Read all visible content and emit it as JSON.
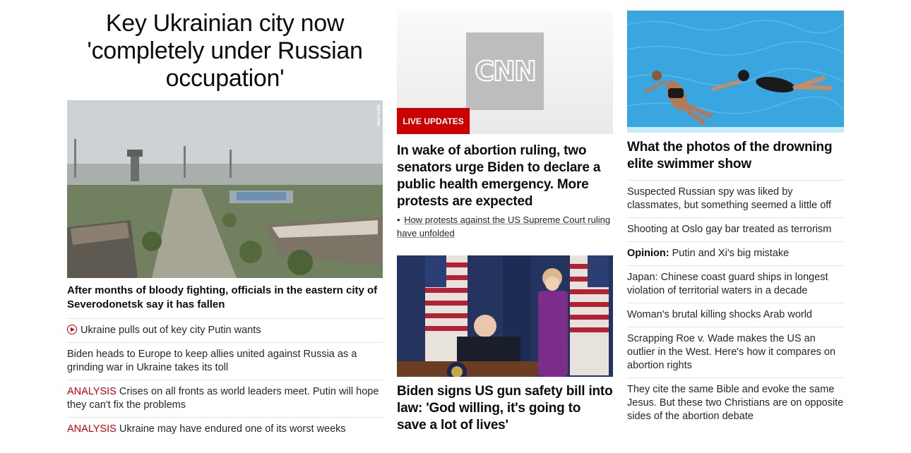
{
  "left": {
    "headline": "Key Ukrainian city now 'completely under Russian occupation'",
    "photo_credit": "REUTERS",
    "caption": "After months of bloody fighting, officials in the eastern city of Severodonetsk say it has fallen",
    "items": [
      {
        "tag": "",
        "text": "Ukraine pulls out of key city Putin wants",
        "video": true
      },
      {
        "tag": "",
        "text": "Biden heads to Europe to keep allies united against Russia as a grinding war in Ukraine takes its toll",
        "video": false
      },
      {
        "tag": "ANALYSIS",
        "text": " Crises on all fronts as world leaders meet. Putin will hope they can't fix the problems",
        "video": false
      },
      {
        "tag": "ANALYSIS",
        "text": " Ukraine may have endured one of its worst weeks",
        "video": false
      }
    ]
  },
  "middle": {
    "logo_text": "CNN",
    "badge": "LIVE UPDATES",
    "headline": "In wake of abortion ruling, two senators urge Biden to declare a public health emergency. More protests are expected",
    "sub_link": "How protests against the US Supreme Court ruling have unfolded",
    "second_headline": "Biden signs US gun safety bill into law: 'God willing, it's going to save a lot of lives'"
  },
  "right": {
    "headline": "What the photos of the drowning elite swimmer show",
    "items": [
      {
        "prefix": "",
        "text": "Suspected Russian spy was liked by classmates, but something seemed a little off"
      },
      {
        "prefix": "",
        "text": "Shooting at Oslo gay bar treated as terrorism"
      },
      {
        "prefix": "Opinion:",
        "text": " Putin and Xi's big mistake"
      },
      {
        "prefix": "",
        "text": "Japan: Chinese coast guard ships in longest violation of territorial waters in a decade"
      },
      {
        "prefix": "",
        "text": "Woman's brutal killing shocks Arab world"
      },
      {
        "prefix": "",
        "text": "Scrapping Roe v. Wade makes the US an outlier in the West. Here's how it compares on abortion rights"
      },
      {
        "prefix": "",
        "text": "They cite the same Bible and evoke the same Jesus. But these two Christians are on opposite sides of the abortion debate"
      }
    ]
  },
  "colors": {
    "accent": "#cc0000",
    "text": "#0c0c0c",
    "divider": "#e6e6e6"
  }
}
